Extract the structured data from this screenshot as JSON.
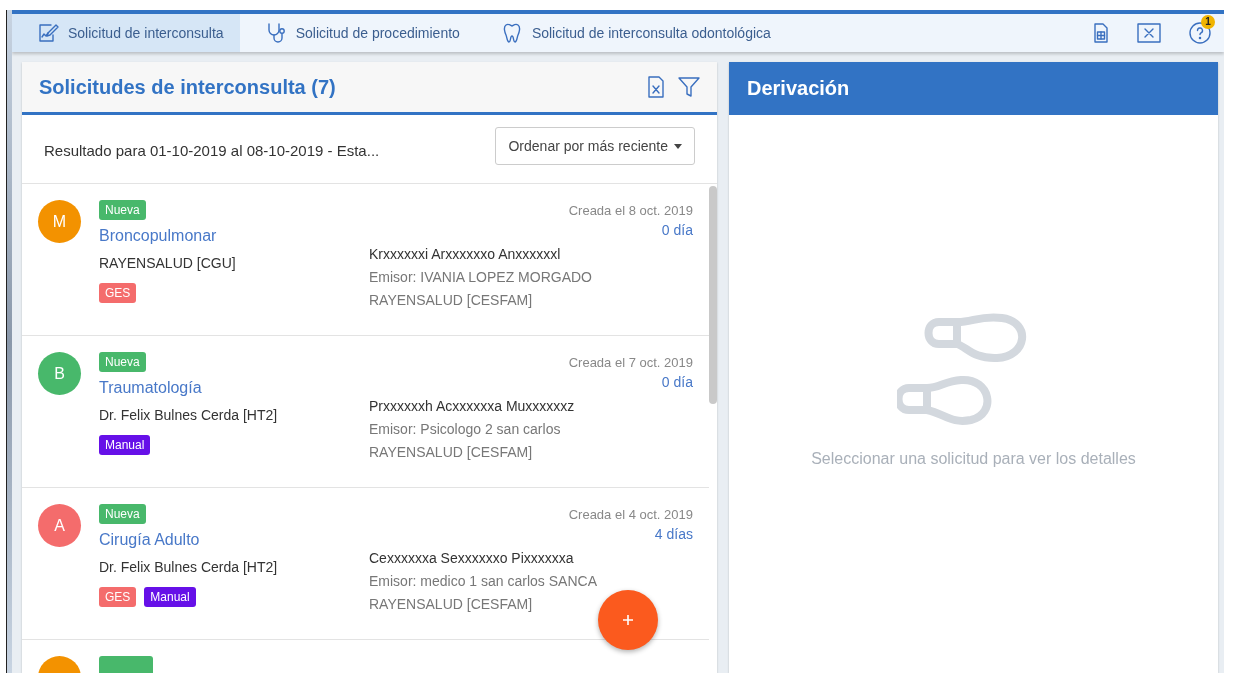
{
  "tabs": [
    {
      "label": "Solicitud de interconsulta",
      "selected": true
    },
    {
      "label": "Solicitud de procedimiento",
      "selected": false
    },
    {
      "label": "Solicitud de interconsulta odontológica",
      "selected": false
    }
  ],
  "toolbar": {
    "notification_count": "1"
  },
  "list_panel": {
    "title": "Solicitudes de interconsulta (7)",
    "result_text": "Resultado para 01-10-2019 al 08-10-2019 - Esta...",
    "sort_button": "Ordenar por más reciente",
    "items": [
      {
        "initial": "M",
        "color": "#f39200",
        "status": "Nueva",
        "specialty": "Broncopulmonar",
        "destination": "RAYENSALUD [CGU]",
        "tags": [
          {
            "label": "GES",
            "color": "#f46c6c"
          }
        ],
        "created": "Creada el 8 oct. 2019",
        "age": "0 día",
        "patient": "Krxxxxxxi Arxxxxxxo Anxxxxxxl",
        "sender": "Emisor: IVANIA LOPEZ MORGADO",
        "origin": "RAYENSALUD [CESFAM]"
      },
      {
        "initial": "B",
        "color": "#48b86b",
        "status": "Nueva",
        "specialty": "Traumatología",
        "destination": "Dr. Felix Bulnes Cerda [HT2]",
        "tags": [
          {
            "label": "Manual",
            "color": "#6610e8"
          }
        ],
        "created": "Creada el 7 oct. 2019",
        "age": "0 día",
        "patient": "Prxxxxxxh Acxxxxxxa Muxxxxxxz",
        "sender": "Emisor: Psicologo 2 san carlos",
        "origin": "RAYENSALUD [CESFAM]"
      },
      {
        "initial": "A",
        "color": "#f46c6c",
        "status": "Nueva",
        "specialty": "Cirugía Adulto",
        "destination": "Dr. Felix Bulnes Cerda [HT2]",
        "tags": [
          {
            "label": "GES",
            "color": "#f46c6c"
          },
          {
            "label": "Manual",
            "color": "#6610e8"
          }
        ],
        "created": "Creada el 4 oct. 2019",
        "age": "4 días",
        "patient": "Cexxxxxxa Sexxxxxxo Pixxxxxxa",
        "sender": "Emisor: medico 1 san carlos SANCA",
        "origin": "RAYENSALUD [CESFAM]"
      },
      {
        "color": "#f39200"
      }
    ]
  },
  "detail_panel": {
    "title": "Derivación",
    "empty_message": "Seleccionar una solicitud para ver los detalles"
  }
}
